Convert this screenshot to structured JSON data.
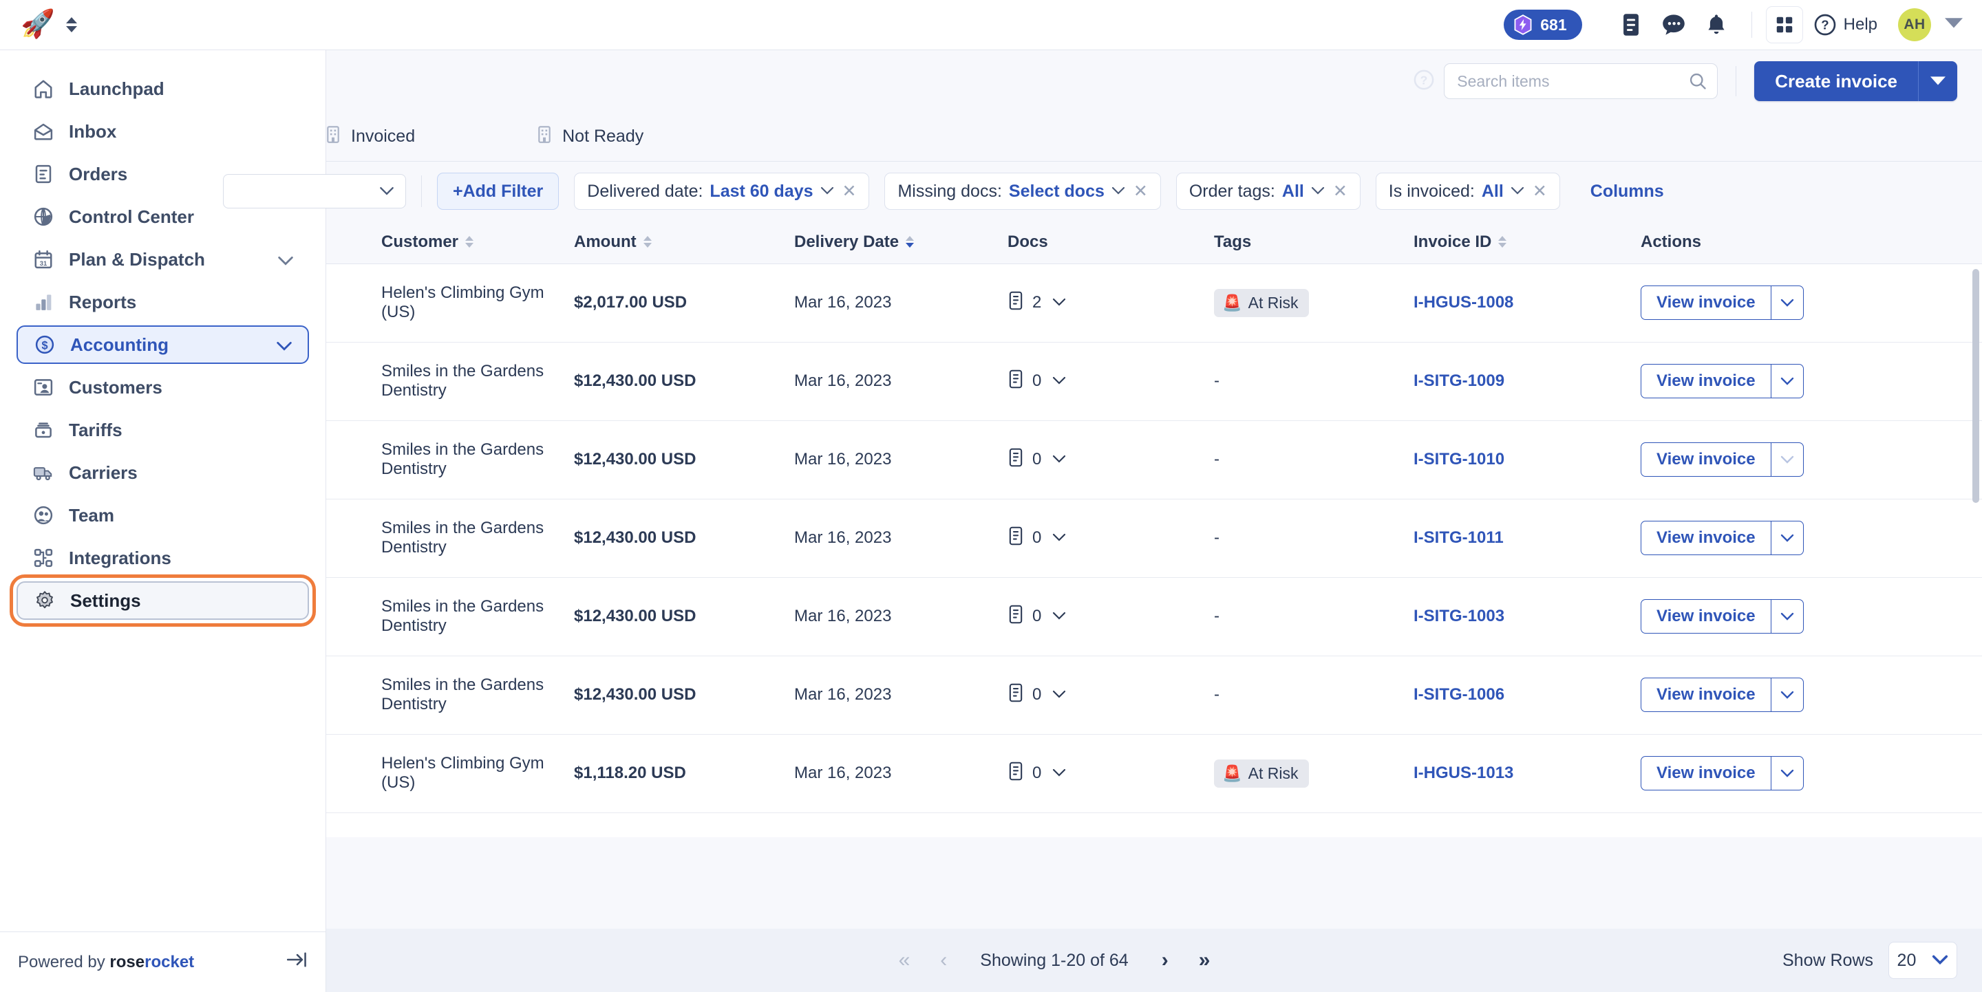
{
  "topbar": {
    "logo_icon": "rocket-icon",
    "switcher_icon": "up-down-chevron-icon",
    "credits": "681",
    "credits_icon": "gem-bolt-icon",
    "icons": [
      "document-icon",
      "chat-bubble-icon",
      "bell-icon"
    ],
    "apps_icon": "grid-apps-icon",
    "help_label": "Help",
    "help_icon": "question-circle-icon",
    "avatar_initials": "AH",
    "avatar_caret_icon": "chevron-down-icon"
  },
  "sidebar": {
    "items": [
      {
        "label": "Launchpad",
        "icon": "home-icon",
        "state": "normal",
        "caret": ""
      },
      {
        "label": "Inbox",
        "icon": "inbox-icon",
        "state": "normal",
        "caret": ""
      },
      {
        "label": "Orders",
        "icon": "orders-icon",
        "state": "normal",
        "caret": ""
      },
      {
        "label": "Control Center",
        "icon": "globe-icon",
        "state": "normal",
        "caret": ""
      },
      {
        "label": "Plan & Dispatch",
        "icon": "calendar-icon",
        "state": "normal",
        "caret": "⌄"
      },
      {
        "label": "Reports",
        "icon": "bar-chart-icon",
        "state": "normal",
        "caret": ""
      },
      {
        "label": "Accounting",
        "icon": "dollar-circle-icon",
        "state": "active",
        "caret": "⌄"
      },
      {
        "label": "Customers",
        "icon": "customers-icon",
        "state": "normal",
        "caret": ""
      },
      {
        "label": "Tariffs",
        "icon": "tariffs-icon",
        "state": "normal",
        "caret": ""
      },
      {
        "label": "Carriers",
        "icon": "truck-icon",
        "state": "normal",
        "caret": ""
      },
      {
        "label": "Team",
        "icon": "team-icon",
        "state": "normal",
        "caret": ""
      },
      {
        "label": "Integrations",
        "icon": "integrations-icon",
        "state": "normal",
        "caret": ""
      },
      {
        "label": "Settings",
        "icon": "gear-icon",
        "state": "highlight",
        "caret": ""
      }
    ],
    "footer": {
      "powered_by": "Powered by",
      "brand_first": "rose",
      "brand_second": "rocket",
      "collapse_icon": "collapse-sidebar-icon"
    }
  },
  "header": {
    "help_icon": "question-circle-icon",
    "search": {
      "placeholder": "Search items",
      "value": "",
      "icon": "search-icon"
    },
    "create_button": {
      "label": "Create invoice",
      "caret_icon": "chevron-down-icon"
    }
  },
  "tabs": [
    {
      "label": "Invoiced",
      "icon": "building-icon",
      "active": false
    },
    {
      "label": "Not Ready",
      "icon": "building-icon",
      "active": false
    }
  ],
  "filters": {
    "select_stub_caret": "⌄",
    "add_filter_label": "+Add Filter",
    "chips": [
      {
        "label": "Delivered date:",
        "value": "Last 60 days",
        "caret": "⌄",
        "close": "✕"
      },
      {
        "label": "Missing docs:",
        "value": "Select docs",
        "caret": "⌄",
        "close": "✕"
      },
      {
        "label": "Order tags:",
        "value": "All",
        "caret": "⌄",
        "close": "✕"
      },
      {
        "label": "Is invoiced:",
        "value": "All",
        "caret": "⌄",
        "close": "✕"
      }
    ],
    "columns_label": "Columns"
  },
  "table": {
    "columns": [
      {
        "key": "customer",
        "label": "Customer",
        "sortable": true,
        "sort": "none"
      },
      {
        "key": "amount",
        "label": "Amount",
        "sortable": true,
        "sort": "none"
      },
      {
        "key": "delivery",
        "label": "Delivery Date",
        "sortable": true,
        "sort": "desc"
      },
      {
        "key": "docs",
        "label": "Docs",
        "sortable": false,
        "sort": "none"
      },
      {
        "key": "tags",
        "label": "Tags",
        "sortable": false,
        "sort": "none"
      },
      {
        "key": "invoice",
        "label": "Invoice ID",
        "sortable": true,
        "sort": "none"
      },
      {
        "key": "actions",
        "label": "Actions",
        "sortable": false,
        "sort": "none"
      }
    ],
    "action_label": "View invoice",
    "rows": [
      {
        "customer": "Helen's Climbing Gym (US)",
        "amount": "$2,017.00 USD",
        "delivery": "Mar 16, 2023",
        "docs": "2",
        "tag": "At Risk",
        "invoice": "I-HGUS-1008",
        "dim": false
      },
      {
        "customer": "Smiles in the Gardens Dentistry",
        "amount": "$12,430.00 USD",
        "delivery": "Mar 16, 2023",
        "docs": "0",
        "tag": "-",
        "invoice": "I-SITG-1009",
        "dim": false
      },
      {
        "customer": "Smiles in the Gardens Dentistry",
        "amount": "$12,430.00 USD",
        "delivery": "Mar 16, 2023",
        "docs": "0",
        "tag": "-",
        "invoice": "I-SITG-1010",
        "dim": true
      },
      {
        "customer": "Smiles in the Gardens Dentistry",
        "amount": "$12,430.00 USD",
        "delivery": "Mar 16, 2023",
        "docs": "0",
        "tag": "-",
        "invoice": "I-SITG-1011",
        "dim": false
      },
      {
        "customer": "Smiles in the Gardens Dentistry",
        "amount": "$12,430.00 USD",
        "delivery": "Mar 16, 2023",
        "docs": "0",
        "tag": "-",
        "invoice": "I-SITG-1003",
        "dim": false
      },
      {
        "customer": "Smiles in the Gardens Dentistry",
        "amount": "$12,430.00 USD",
        "delivery": "Mar 16, 2023",
        "docs": "0",
        "tag": "-",
        "invoice": "I-SITG-1006",
        "dim": false
      },
      {
        "customer": "Helen's Climbing Gym (US)",
        "amount": "$1,118.20 USD",
        "delivery": "Mar 16, 2023",
        "docs": "0",
        "tag": "At Risk",
        "invoice": "I-HGUS-1013",
        "dim": false
      }
    ]
  },
  "footer": {
    "first_icon": "«",
    "prev_icon": "‹",
    "showing_text": "Showing 1-20 of 64",
    "next_icon": "›",
    "last_icon": "»",
    "rows_label": "Show Rows",
    "rows_value": "20",
    "rows_caret": "⌄"
  },
  "colors": {
    "brand_blue": "#2f55b8",
    "accent_orange": "#ef7c3c",
    "avatar_green": "#d5de58",
    "page_bg": "#f7f8fc"
  }
}
